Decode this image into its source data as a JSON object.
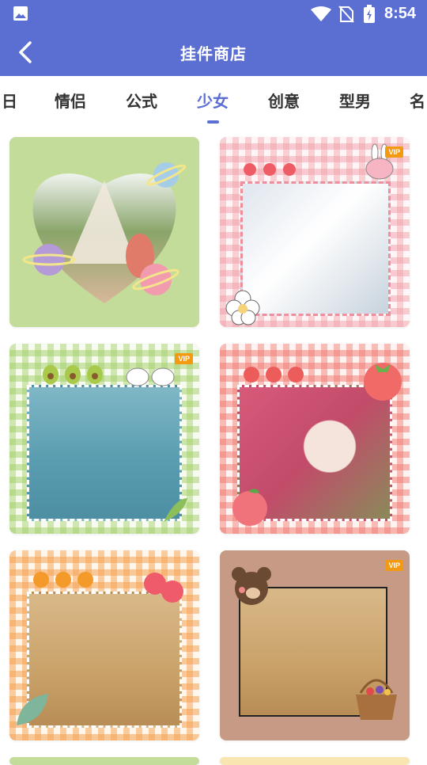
{
  "status": {
    "time": "8:54"
  },
  "appbar": {
    "title": "挂件商店"
  },
  "tabs": [
    {
      "label": "日"
    },
    {
      "label": "情侣"
    },
    {
      "label": "公式"
    },
    {
      "label": "少女",
      "active": true
    },
    {
      "label": "创意"
    },
    {
      "label": "型男"
    },
    {
      "label": "名"
    }
  ],
  "cards": [
    {
      "vip": ""
    },
    {
      "vip": "VIP"
    },
    {
      "vip": "VIP"
    },
    {
      "vip": ""
    },
    {
      "vip": ""
    },
    {
      "vip": "VIP"
    }
  ],
  "colors": {
    "primary": "#5b6fd3",
    "vip": "#f39a12"
  }
}
